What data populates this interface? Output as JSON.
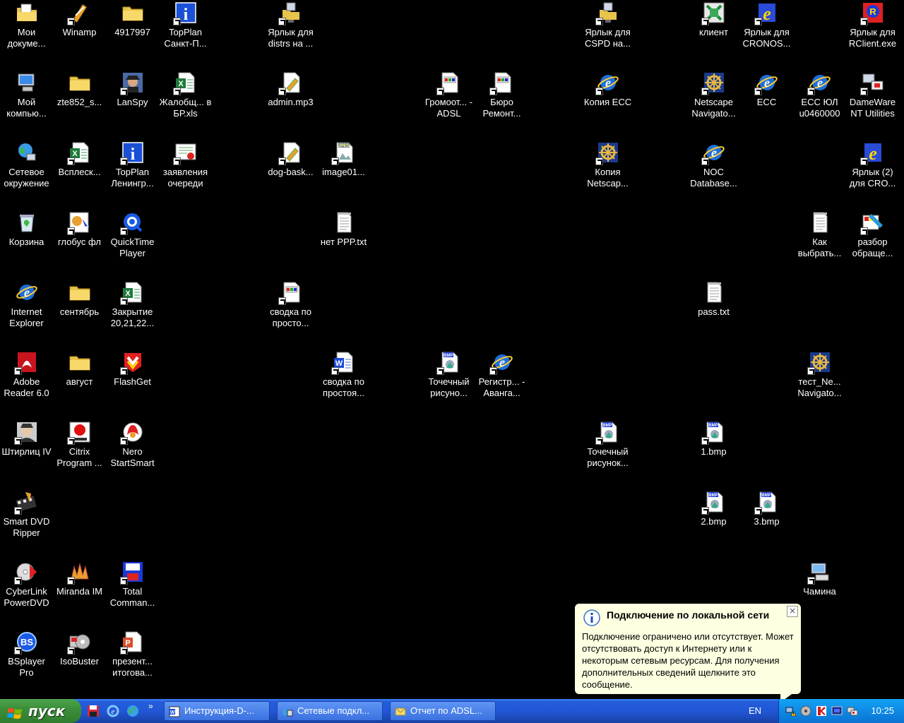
{
  "desktop": {
    "icons": [
      {
        "label": "Мои докуме...",
        "icon": "my-documents-icon"
      },
      {
        "label": "Winamp",
        "icon": "winamp-icon"
      },
      {
        "label": "4917997",
        "icon": "folder-icon"
      },
      {
        "label": "TopPlan Санкт-П...",
        "icon": "topplan-icon"
      },
      {
        "label": "Ярлык для distrs на ...",
        "icon": "network-folder-icon"
      },
      {
        "label": "Ярлык для CSPD на...",
        "icon": "network-folder-icon"
      },
      {
        "label": "клиент",
        "icon": "client-app-icon"
      },
      {
        "label": "Ярлык для CRONOS...",
        "icon": "cronos-icon"
      },
      {
        "label": "Ярлык для RClient.exe",
        "icon": "rclient-icon"
      },
      {
        "label": "Мой компью...",
        "icon": "my-computer-icon"
      },
      {
        "label": "zte852_s...",
        "icon": "folder-icon"
      },
      {
        "label": "LanSpy",
        "icon": "lanspy-icon"
      },
      {
        "label": "Жалобщ... в БР.xls",
        "icon": "excel-file-icon"
      },
      {
        "label": "admin.mp3",
        "icon": "audio-file-icon"
      },
      {
        "label": "Громоот... - ADSL",
        "icon": "document-shortcut-icon"
      },
      {
        "label": "Бюро Ремонт...",
        "icon": "document-shortcut-icon"
      },
      {
        "label": "Копия ECC",
        "icon": "ie-shortcut-icon"
      },
      {
        "label": "Netscape Navigato...",
        "icon": "netscape-icon"
      },
      {
        "label": "ECC",
        "icon": "ie-shortcut-icon"
      },
      {
        "label": "ECC ЮЛ u0460000",
        "icon": "ie-shortcut-icon"
      },
      {
        "label": "DameWare NT Utilities",
        "icon": "dameware-icon"
      },
      {
        "label": "Сетевое окружение",
        "icon": "network-places-icon"
      },
      {
        "label": "Всплеск...",
        "icon": "excel-file-icon"
      },
      {
        "label": "TopPlan Ленингр...",
        "icon": "topplan-icon"
      },
      {
        "label": "заявления очереди",
        "icon": "certificate-icon"
      },
      {
        "label": "dog-bask...",
        "icon": "audio-file-icon"
      },
      {
        "label": "image01...",
        "icon": "jpeg-file-icon"
      },
      {
        "label": "Копия Netscap...",
        "icon": "netscape-icon"
      },
      {
        "label": "NOC Database...",
        "icon": "ie-shortcut-icon"
      },
      {
        "label": "Ярлык (2) для CRO...",
        "icon": "cronos-icon"
      },
      {
        "label": "Корзина",
        "icon": "recycle-bin-icon"
      },
      {
        "label": "глобус фл",
        "icon": "globus-icon"
      },
      {
        "label": "QuickTime Player",
        "icon": "quicktime-icon"
      },
      {
        "label": "нет PPP.txt",
        "icon": "text-file-icon"
      },
      {
        "label": "Как выбрать...",
        "icon": "text-file-icon"
      },
      {
        "label": "разбор обраще...",
        "icon": "paint-icon"
      },
      {
        "label": "Internet Explorer",
        "icon": "internet-explorer-icon"
      },
      {
        "label": "сентябрь",
        "icon": "folder-icon"
      },
      {
        "label": "Закрытие 20,21,22...",
        "icon": "excel-file-icon"
      },
      {
        "label": "сводка по просто...",
        "icon": "document-shortcut-icon"
      },
      {
        "label": "pass.txt",
        "icon": "text-file-icon"
      },
      {
        "label": "Adobe Reader 6.0",
        "icon": "adobe-reader-icon"
      },
      {
        "label": "август",
        "icon": "folder-icon"
      },
      {
        "label": "FlashGet",
        "icon": "flashget-icon"
      },
      {
        "label": "сводка по простоя...",
        "icon": "word-file-icon"
      },
      {
        "label": "Точечный рисуно...",
        "icon": "bmp-file-icon"
      },
      {
        "label": "Регистр... - Аванга...",
        "icon": "ie-shortcut-icon"
      },
      {
        "label": "тест_Ne... Navigato...",
        "icon": "netscape-icon"
      },
      {
        "label": "Штирлиц IV",
        "icon": "shtirlitz-icon"
      },
      {
        "label": "Citrix Program ...",
        "icon": "citrix-icon"
      },
      {
        "label": "Nero StartSmart",
        "icon": "nero-icon"
      },
      {
        "label": "Точечный рисунок...",
        "icon": "bmp-file-icon"
      },
      {
        "label": "1.bmp",
        "icon": "bmp-file-icon"
      },
      {
        "label": "Smart DVD Ripper",
        "icon": "dvd-ripper-icon"
      },
      {
        "label": "2.bmp",
        "icon": "bmp-file-icon"
      },
      {
        "label": "3.bmp",
        "icon": "bmp-file-icon"
      },
      {
        "label": "CyberLink PowerDVD",
        "icon": "powerdvd-icon"
      },
      {
        "label": "Miranda IM",
        "icon": "miranda-icon"
      },
      {
        "label": "Total Comman...",
        "icon": "total-commander-icon"
      },
      {
        "label": "Чамина",
        "icon": "network-computer-icon"
      },
      {
        "label": "BSplayer Pro",
        "icon": "bsplayer-icon"
      },
      {
        "label": "IsoBuster",
        "icon": "isobuster-icon"
      },
      {
        "label": "презент... итогова...",
        "icon": "powerpoint-file-icon"
      }
    ]
  },
  "balloon": {
    "title": "Подключение по локальной сети",
    "body": "Подключение ограничено или отсутствует. Может отсутствовать доступ к Интернету или к некоторым сетевым ресурсам. Для получения дополнительных сведений щелкните это сообщение.",
    "close_glyph": "×"
  },
  "taskbar": {
    "start_label": "пуск",
    "quicklaunch_more": "»",
    "tasks": [
      {
        "label": "Инструкция-D-...",
        "icon": "word-icon"
      },
      {
        "label": "Сетевые подкл...",
        "icon": "network-connections-icon"
      },
      {
        "label": "Отчет по ADSL...",
        "icon": "email-icon"
      }
    ],
    "language": "EN",
    "clock": "10:25"
  },
  "colors": {
    "taskbar_blue": "#245edb",
    "start_green": "#3c8f3a",
    "tray_blue": "#0e8ae6",
    "balloon_bg": "#ffffe1",
    "desktop_bg": "#000000"
  }
}
